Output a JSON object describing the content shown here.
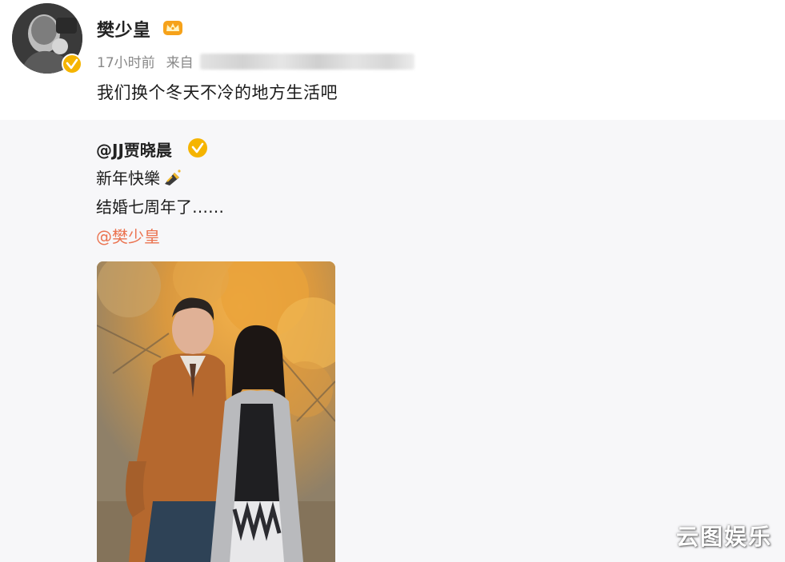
{
  "post": {
    "author": "樊少皇",
    "time": "17小时前",
    "source_prefix": "来自",
    "text": "我们换个冬天不冷的地方生活吧"
  },
  "repost": {
    "author": "@JJ贾晓晨",
    "line1": "新年快樂",
    "line2": "结婚七周年了……",
    "mention": "@樊少皇"
  },
  "watermark": "云图娱乐",
  "colors": {
    "verified": "#f5b400",
    "mention": "#eb7350",
    "repost_bg": "#f7f7f9"
  },
  "icons": {
    "verified": "verified-badge-icon",
    "member": "crown-icon",
    "emoji": "firecracker-icon"
  }
}
